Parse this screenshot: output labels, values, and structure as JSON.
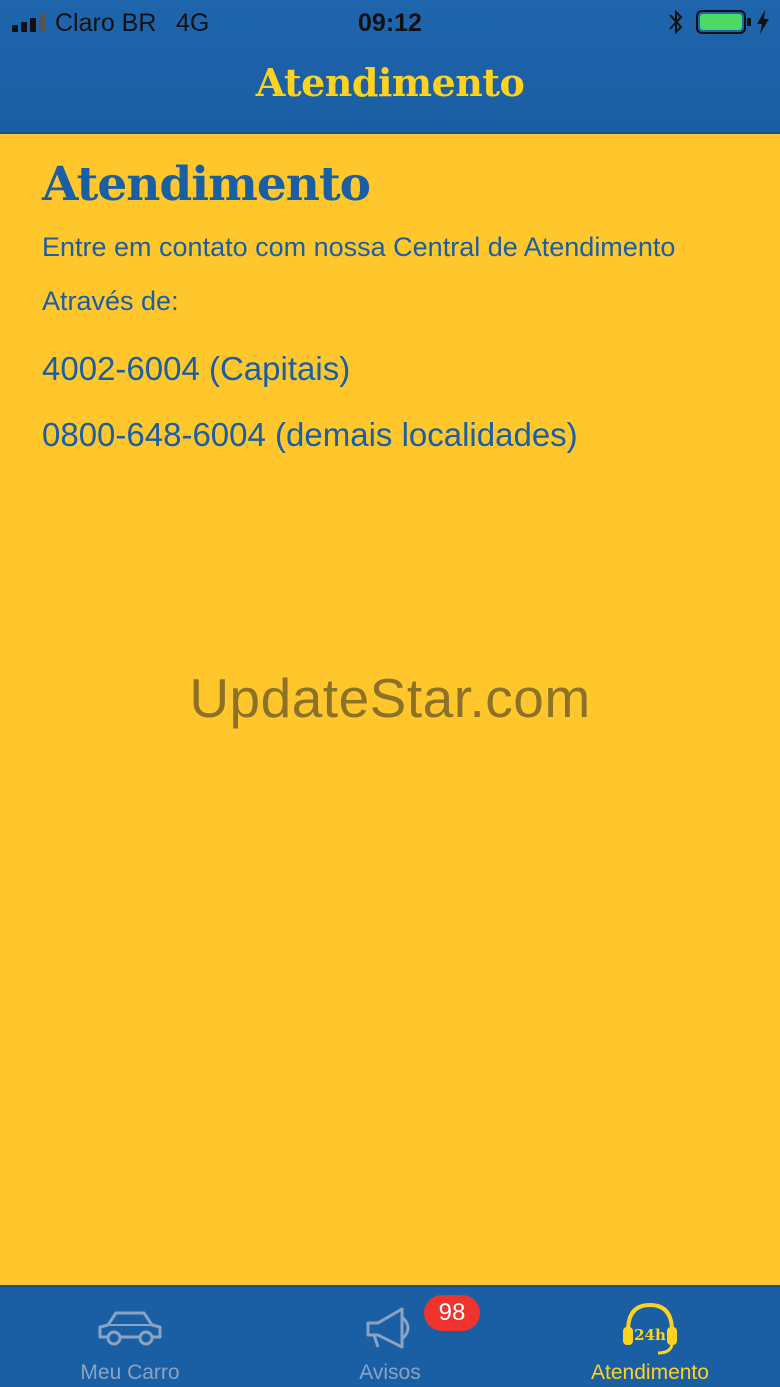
{
  "status_bar": {
    "carrier": "Claro BR",
    "network": "4G",
    "time": "09:12"
  },
  "nav": {
    "title": "Atendimento"
  },
  "content": {
    "title": "Atendimento",
    "intro": "Entre em contato com nossa Central de Atendimento",
    "through": "Através de:",
    "phones": [
      "4002-6004 (Capitais)",
      "0800-648-6004 (demais localidades)"
    ]
  },
  "watermark": "UpdateStar.com",
  "tabbar": {
    "tabs": [
      {
        "label": "Meu Carro",
        "icon": "car-icon"
      },
      {
        "label": "Avisos",
        "icon": "megaphone-icon",
        "badge": "98"
      },
      {
        "label": "Atendimento",
        "icon": "headset-24h-icon",
        "active": true
      }
    ]
  },
  "colors": {
    "background": "#ffc72c",
    "primary_blue": "#1a5ea3",
    "accent_yellow": "#ffd21f",
    "badge_red": "#f0332c",
    "inactive_tab": "#8aa3c2"
  }
}
